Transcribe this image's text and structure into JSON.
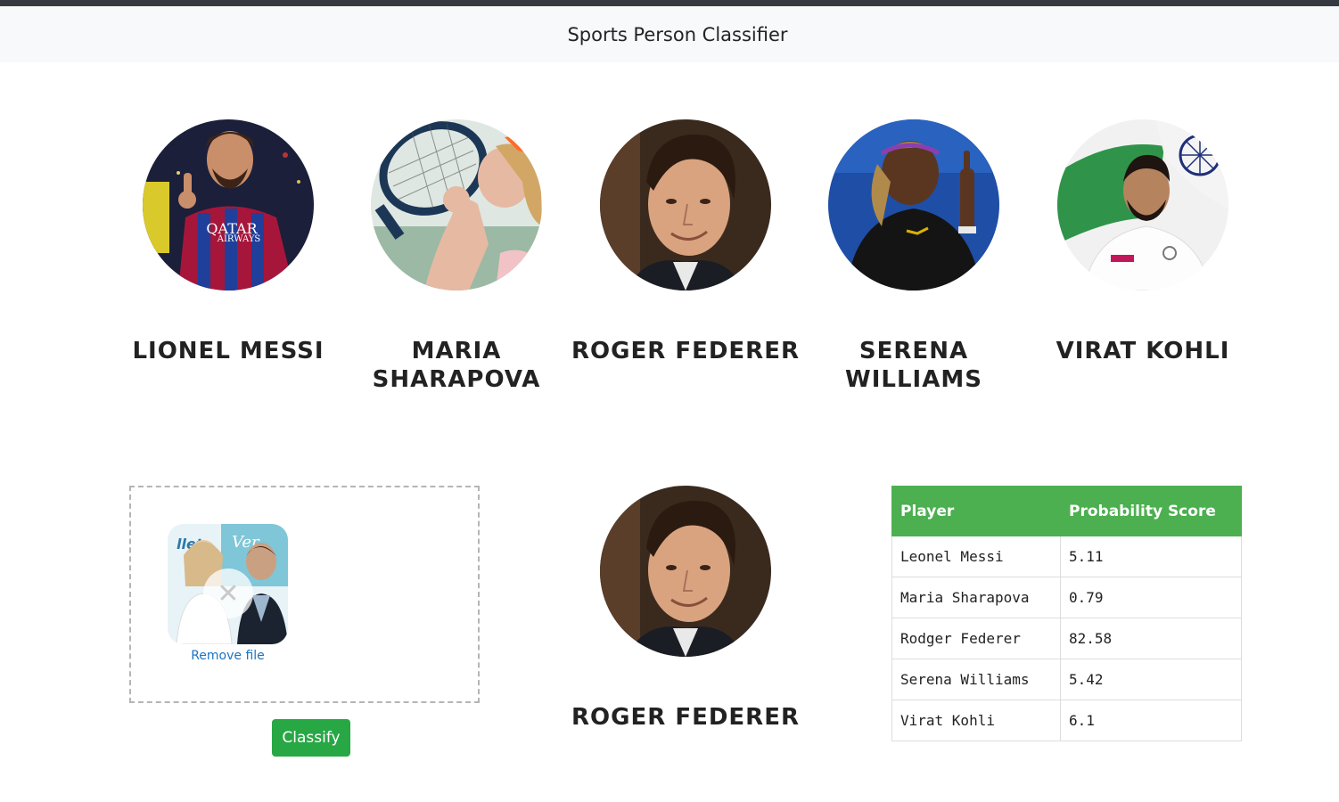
{
  "app": {
    "title": "Sports Person Classifier"
  },
  "players": [
    {
      "name": "Lionel Messi",
      "photo": "messi-photo"
    },
    {
      "name": "Maria Sharapova",
      "photo": "sharapova-photo"
    },
    {
      "name": "Roger Federer",
      "photo": "federer-photo"
    },
    {
      "name": "Serena Williams",
      "photo": "serena-photo"
    },
    {
      "name": "Virat Kohli",
      "photo": "kohli-photo"
    }
  ],
  "upload": {
    "remove_label": "Remove file",
    "remove_icon": "close-icon",
    "classify_label": "Classify"
  },
  "result": {
    "name": "Roger Federer"
  },
  "table": {
    "headers": [
      "Player",
      "Probability Score"
    ],
    "rows": [
      [
        "Leonel Messi",
        "5.11"
      ],
      [
        "Maria Sharapova",
        "0.79"
      ],
      [
        "Rodger Federer",
        "82.58"
      ],
      [
        "Serena Williams",
        "5.42"
      ],
      [
        "Virat Kohli",
        "6.1"
      ]
    ]
  },
  "colors": {
    "accent_green": "#28a745",
    "table_header_green": "#4caf50",
    "navbar_bg": "#f8f9fa",
    "link_blue": "#1b74c5"
  }
}
